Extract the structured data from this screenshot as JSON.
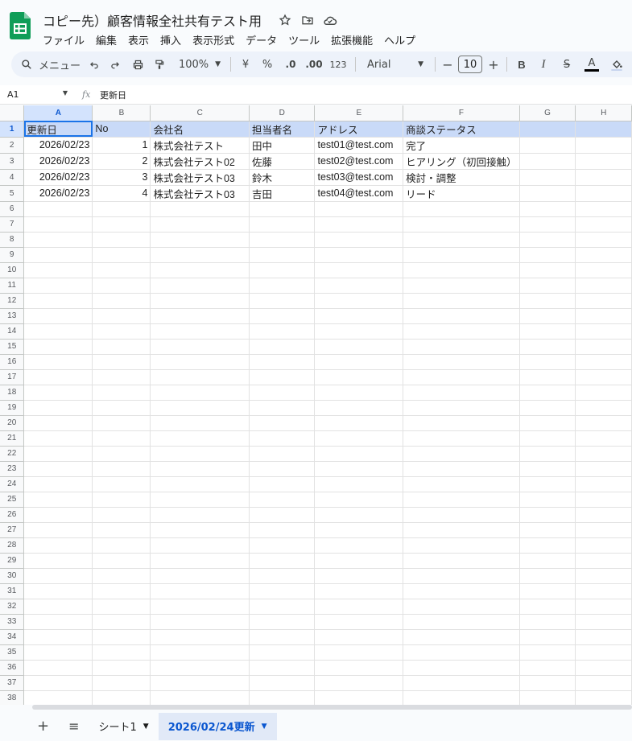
{
  "title": "コピー先）顧客情報全社共有テスト用",
  "menu": [
    "ファイル",
    "編集",
    "表示",
    "挿入",
    "表示形式",
    "データ",
    "ツール",
    "拡張機能",
    "ヘルプ"
  ],
  "toolbar": {
    "search": "メニュー",
    "zoom": "100%",
    "currency": "¥",
    "percent": "%",
    "dec_decrease": ".0",
    "dec_increase": ".00",
    "format_123": "123",
    "font": "Arial",
    "font_size": "10",
    "bold": "B",
    "italic": "I",
    "strike": "S",
    "text_color": "A"
  },
  "formula_bar": {
    "cell_ref": "A1",
    "fx": "fx",
    "content": "更新日"
  },
  "columns": [
    "A",
    "B",
    "C",
    "D",
    "E",
    "F",
    "G",
    "H"
  ],
  "rows": [
    [
      "更新日",
      "No",
      "会社名",
      "担当者名",
      "アドレス",
      "商談ステータス",
      "",
      ""
    ],
    [
      "2026/02/23",
      "1",
      "株式会社テスト",
      "田中",
      "test01@test.com",
      "完了",
      "",
      ""
    ],
    [
      "2026/02/23",
      "2",
      "株式会社テスト02",
      "佐藤",
      "test02@test.com",
      "ヒアリング（初回接触）",
      "",
      ""
    ],
    [
      "2026/02/23",
      "3",
      "株式会社テスト03",
      "鈴木",
      "test03@test.com",
      "検討・調整",
      "",
      ""
    ],
    [
      "2026/02/23",
      "4",
      "株式会社テスト03",
      "吉田",
      "test04@test.com",
      "リード",
      "",
      ""
    ]
  ],
  "row_count": 38,
  "sheets": [
    "シート1",
    "2026/02/24更新"
  ],
  "active_sheet": "2026/02/24更新",
  "colors": {
    "accent": "#0b57d0",
    "header_fill": "#c9daf8",
    "selection": "#d3e3fd"
  }
}
